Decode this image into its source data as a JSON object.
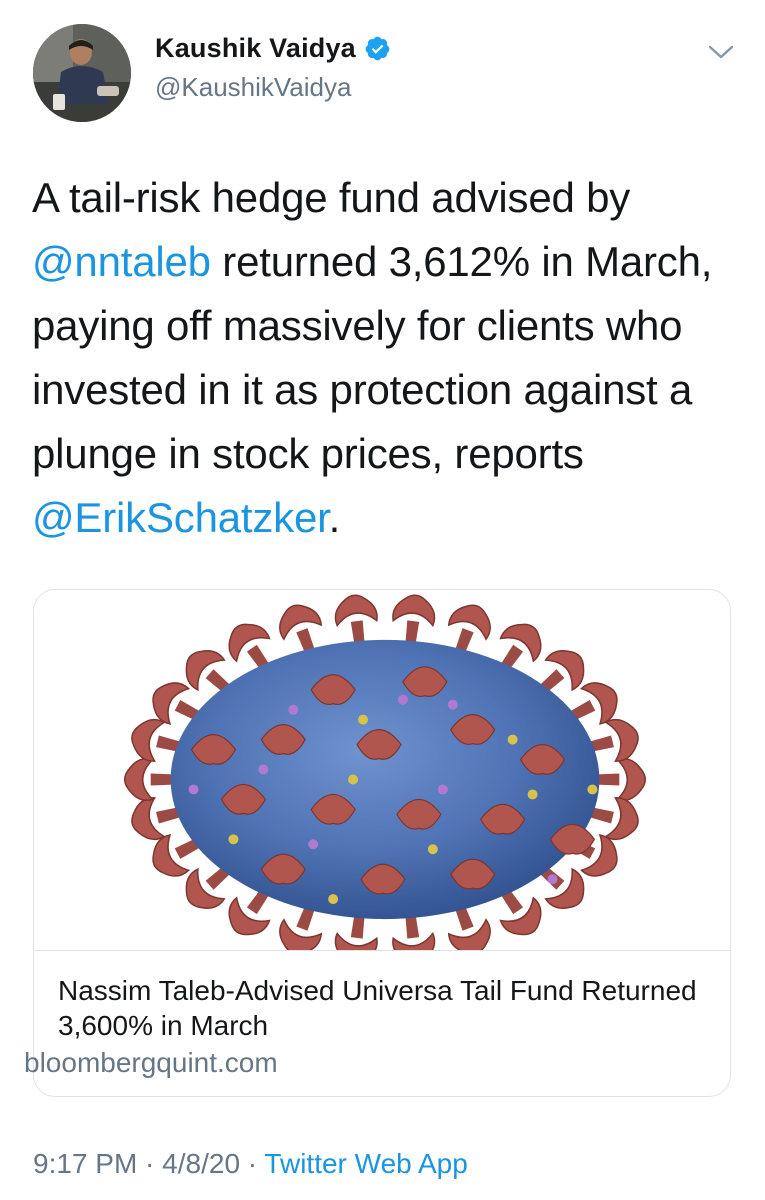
{
  "author": {
    "display_name": "Kaushik Vaidya",
    "handle": "@KaushikVaidya",
    "verified": true
  },
  "tweet": {
    "text_parts": {
      "p1": "A tail-risk hedge fund advised by ",
      "mention1": "@nntaleb",
      "p2": " returned 3,612% in March, paying off massively for clients who invested in it as protection against a plunge in stock prices, reports ",
      "mention2": "@ErikSchatzker",
      "p3": "."
    }
  },
  "card": {
    "title": "Nassim Taleb-Advised Universa Tail Fund Returned 3,600% in March",
    "domain": "bloombergquint.com"
  },
  "meta": {
    "time": "9:17 PM",
    "separator": " · ",
    "date": "4/8/20",
    "source": "Twitter Web App"
  },
  "colors": {
    "accent": "#1b95e0",
    "secondary_text": "#657786",
    "primary_text": "#14171a",
    "verified_badge": "#1da1f2"
  },
  "icons": {
    "verified": "verified-badge-icon",
    "menu": "chevron-down-icon"
  }
}
